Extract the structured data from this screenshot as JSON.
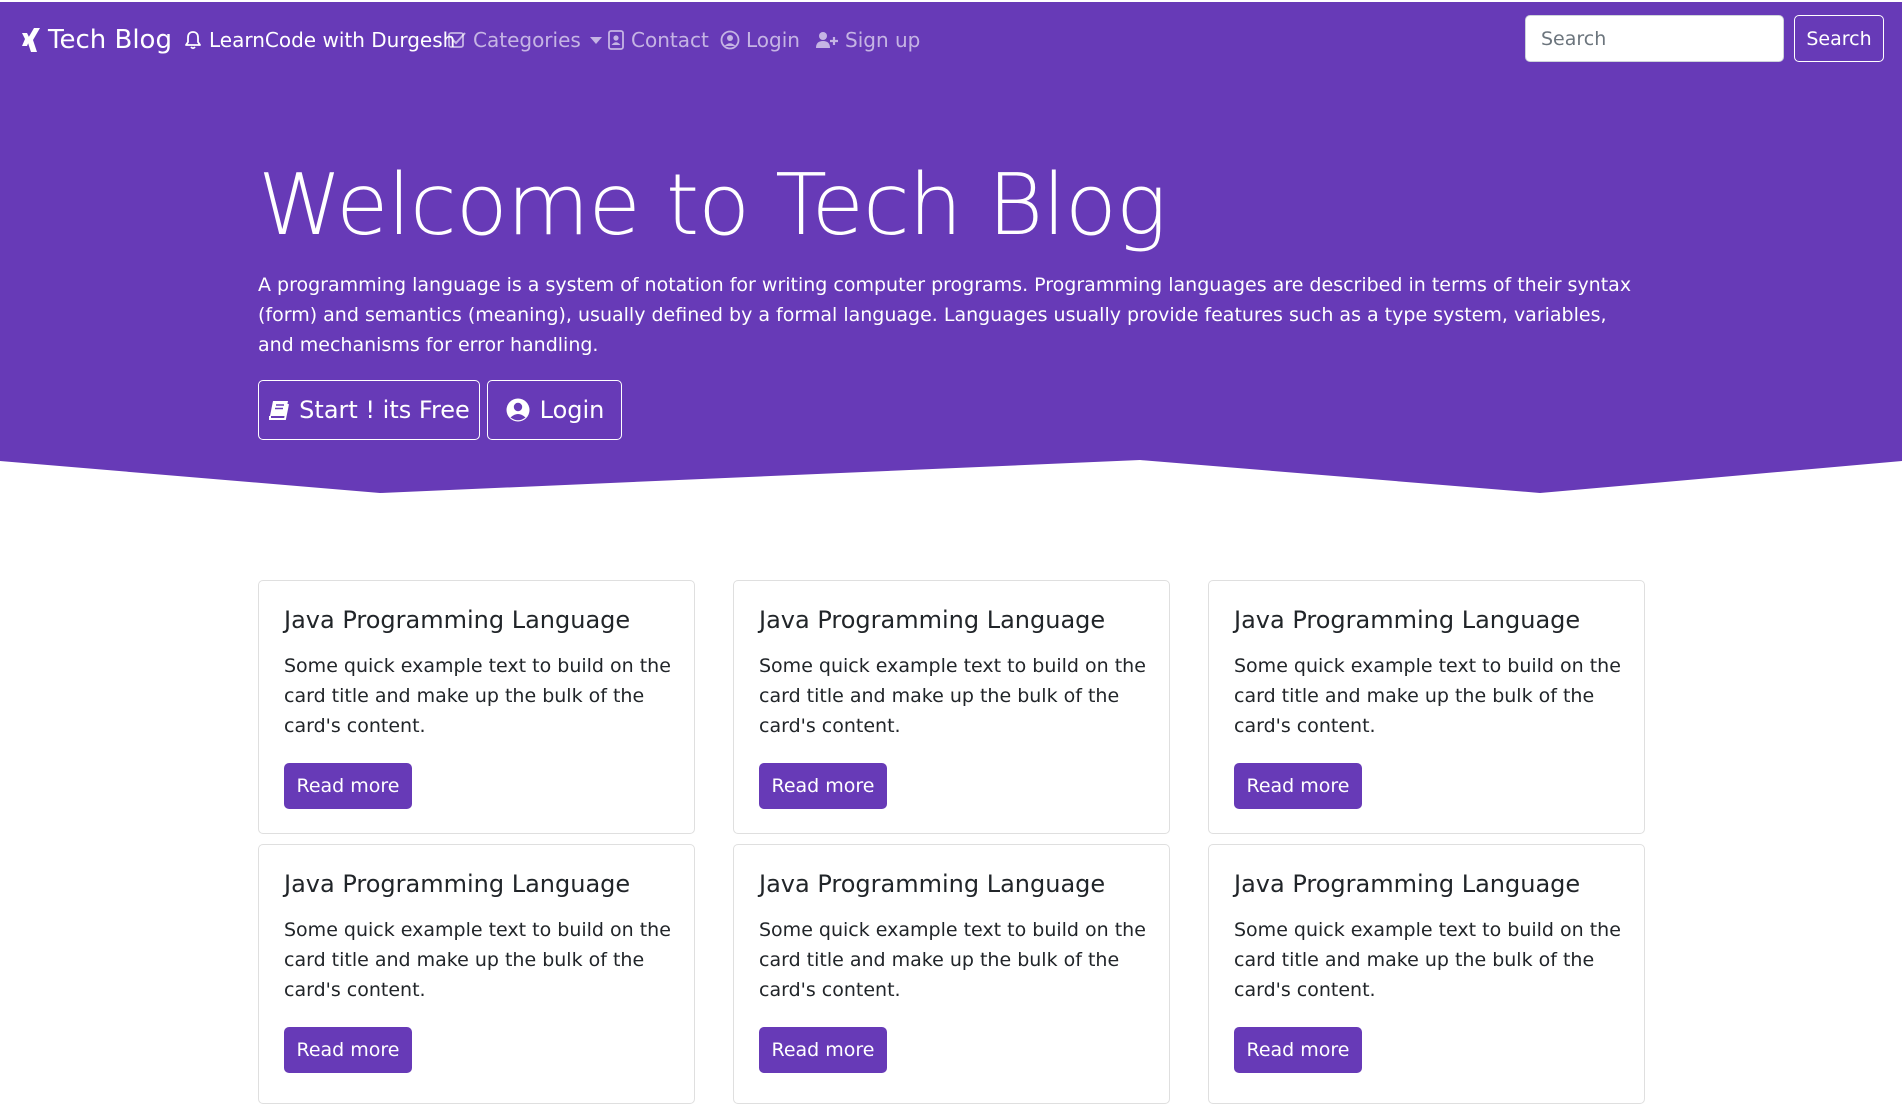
{
  "navbar": {
    "brand": "Tech Blog",
    "items": [
      {
        "label": "LearnCode with Durgesh",
        "icon": "bell-icon"
      },
      {
        "label": "Categories",
        "icon": "check-square-icon"
      },
      {
        "label": "Contact",
        "icon": "address-book-icon"
      },
      {
        "label": "Login",
        "icon": "user-circle-icon"
      },
      {
        "label": "Sign up",
        "icon": "user-plus-icon"
      }
    ],
    "search": {
      "placeholder": "Search",
      "button_label": "Search"
    }
  },
  "hero": {
    "title": "Welcome to Tech Blog",
    "description": "A programming language is a system of notation for writing computer programs. Programming languages are described in terms of their syntax (form) and semantics (meaning), usually defined by a formal language. Languages usually provide features such as a type system, variables, and mechanisms for error handling.",
    "buttons": [
      {
        "label": "Start ! its Free",
        "icon": "book-icon"
      },
      {
        "label": "Login",
        "icon": "user-circle-icon"
      }
    ]
  },
  "cards": [
    {
      "title": "Java Programming Language",
      "text": "Some quick example text to build on the card title and make up the bulk of the card's content.",
      "button": "Read more"
    },
    {
      "title": "Java Programming Language",
      "text": "Some quick example text to build on the card title and make up the bulk of the card's content.",
      "button": "Read more"
    },
    {
      "title": "Java Programming Language",
      "text": "Some quick example text to build on the card title and make up the bulk of the card's content.",
      "button": "Read more"
    },
    {
      "title": "Java Programming Language",
      "text": "Some quick example text to build on the card title and make up the bulk of the card's content.",
      "button": "Read more"
    },
    {
      "title": "Java Programming Language",
      "text": "Some quick example text to build on the card title and make up the bulk of the card's content.",
      "button": "Read more"
    },
    {
      "title": "Java Programming Language",
      "text": "Some quick example text to build on the card title and make up the bulk of the card's content.",
      "button": "Read more"
    }
  ],
  "colors": {
    "primary": "#673ab7",
    "background": "#ffffff",
    "text": "#212529",
    "card_border": "#dfdfdf"
  }
}
